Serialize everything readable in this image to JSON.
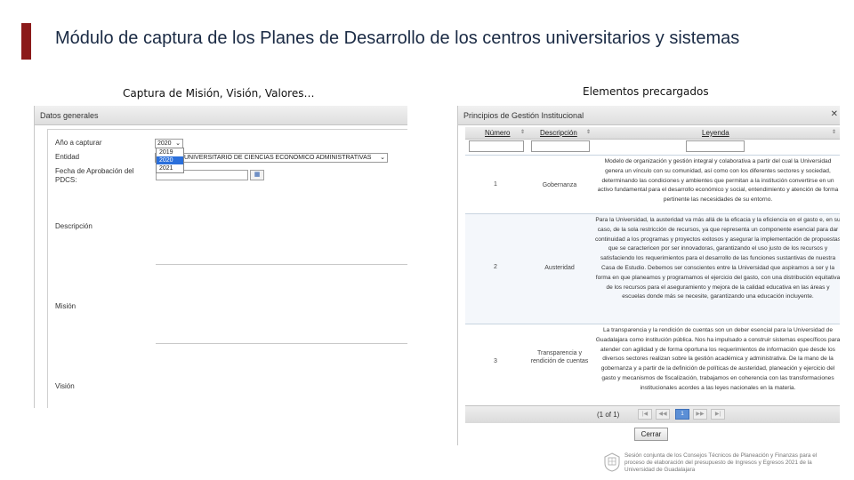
{
  "slide": {
    "title": "Módulo de captura de los Planes de Desarrollo de los centros universitarios y sistemas",
    "caption_left": "Captura de Misión, Visión, Valores…",
    "caption_right": "Elementos precargados",
    "accent_color": "#8b1a1a"
  },
  "form": {
    "header": "Datos generales",
    "year_label": "Año a capturar",
    "year_value": "2020",
    "year_options": [
      "2019",
      "2020",
      "2021"
    ],
    "entity_label": "Entidad",
    "entity_value": "UNIVERSITARIO DE CIENCIAS ECONOMICO ADMINISTRATIVAS",
    "date_label": "Fecha de Aprobación del PDCS:",
    "description_label": "Descripción",
    "mission_label": "Misión",
    "vision_label": "Visión",
    "calendar_icon": "calendar-icon"
  },
  "grid": {
    "header": "Principios de Gestión Institucional",
    "columns": [
      "Número",
      "Descripción",
      "Leyenda"
    ],
    "rows": [
      {
        "number": "1",
        "description": "Gobernanza",
        "legend": "Modelo de organización y gestión integral y colaborativa a partir del cual la Universidad genera un vínculo con su comunidad, así como con los diferentes sectores y sociedad, determinando las condiciones y ambientes que permitan a la institución convertirse en un activo fundamental para el desarrollo económico y social, entendimiento y atención de forma pertinente las necesidades de su entorno."
      },
      {
        "number": "2",
        "description": "Austeridad",
        "legend": "Para la Universidad, la austeridad va más allá de la eficacia y la eficiencia en el gasto e, en su caso, de la sola restricción de recursos, ya que representa un componente esencial para dar continuidad a los programas y proyectos exitosos y asegurar la implementación de propuestas que se caractericen por ser innovadoras, garantizando el uso justo de los recursos y satisfaciendo los requerimientos para el desarrollo de las funciones sustantivas de nuestra Casa de Estudio. Debemos ser conscientes entre la Universidad que aspiramos a ser y la forma en que planeamos y programamos el ejercicio del gasto, con una distribución equitativa de los recursos para el aseguramiento y mejora de la calidad educativa en las áreas y escuelas donde más se necesite, garantizando una educación incluyente."
      },
      {
        "number": "3",
        "description": "Transparencia y rendición de cuentas",
        "legend": "La transparencia y la rendición de cuentas son un deber esencial para la Universidad de Guadalajara como institución pública. Nos ha impulsado a construir sistemas específicos para atender con agilidad y de forma oportuna los requerimientos de información que desde los diversos sectores realizan sobre la gestión académica y administrativa. De la mano de la gobernanza y a partir de la definición de políticas de austeridad, planeación y ejercicio del gasto y mecanismos de fiscalización, trabajamos en coherencia con las transformaciones institucionales acordes a las leyes nacionales en la materia."
      }
    ],
    "pager_info": "(1 of 1)",
    "pager_first": "|◀",
    "pager_prev": "◀◀",
    "pager_page": "1",
    "pager_next": "▶▶",
    "pager_last": "▶|",
    "close_label": "Cerrar"
  },
  "footer": {
    "text": "Sesión conjunta de los Consejos Técnicos de Planeación y Finanzas para el proceso de elaboración del presupuesto de Ingresos y Egresos 2021 de la Universidad de Guadalajara",
    "logo_icon": "university-seal-icon"
  }
}
